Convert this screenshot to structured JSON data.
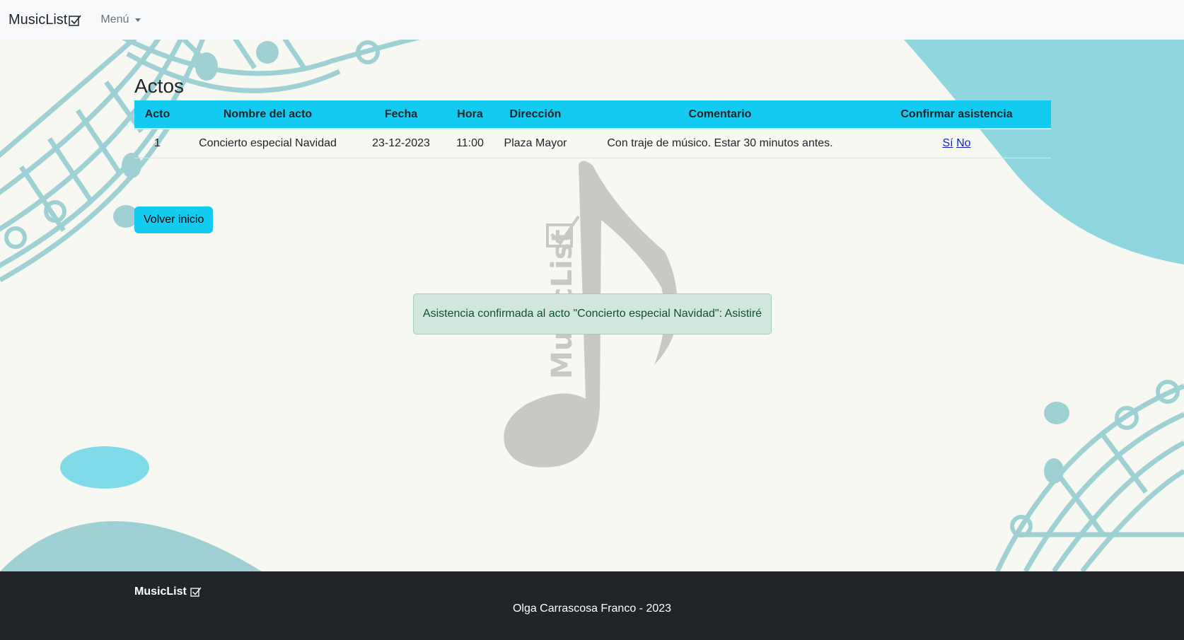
{
  "navbar": {
    "brand": "MusicList",
    "menu_label": "Menú"
  },
  "page": {
    "title": "Actos"
  },
  "table": {
    "headers": [
      "Acto",
      "Nombre del acto",
      "Fecha",
      "Hora",
      "Dirección",
      "Comentario",
      "Confirmar asistencia"
    ],
    "rows": [
      {
        "acto": "1",
        "nombre": "Concierto especial Navidad",
        "fecha": "23-12-2023",
        "hora": "11:00",
        "direccion": "Plaza Mayor",
        "comentario": "Con traje de músico. Estar 30 minutos antes.",
        "si_label": "Sí",
        "no_label": "No"
      }
    ]
  },
  "back_button": "Volver inicio",
  "alert": {
    "message": "Asistencia confirmada al acto \"Concierto especial Navidad\": Asistiré"
  },
  "watermark": {
    "text": "MusicList"
  },
  "footer": {
    "brand": "MusicList",
    "copyright": "Olga Carrascosa Franco - 2023"
  },
  "colors": {
    "accent": "#13caf0",
    "navbar_bg": "#f8f9fa",
    "page_bg": "#f8f8f3",
    "footer_bg": "#212529",
    "alert_bg": "#d1e7dd",
    "alert_text": "#0f5132",
    "staff_teal": "#9fd0d4",
    "note_gray": "#c8c8c4"
  }
}
